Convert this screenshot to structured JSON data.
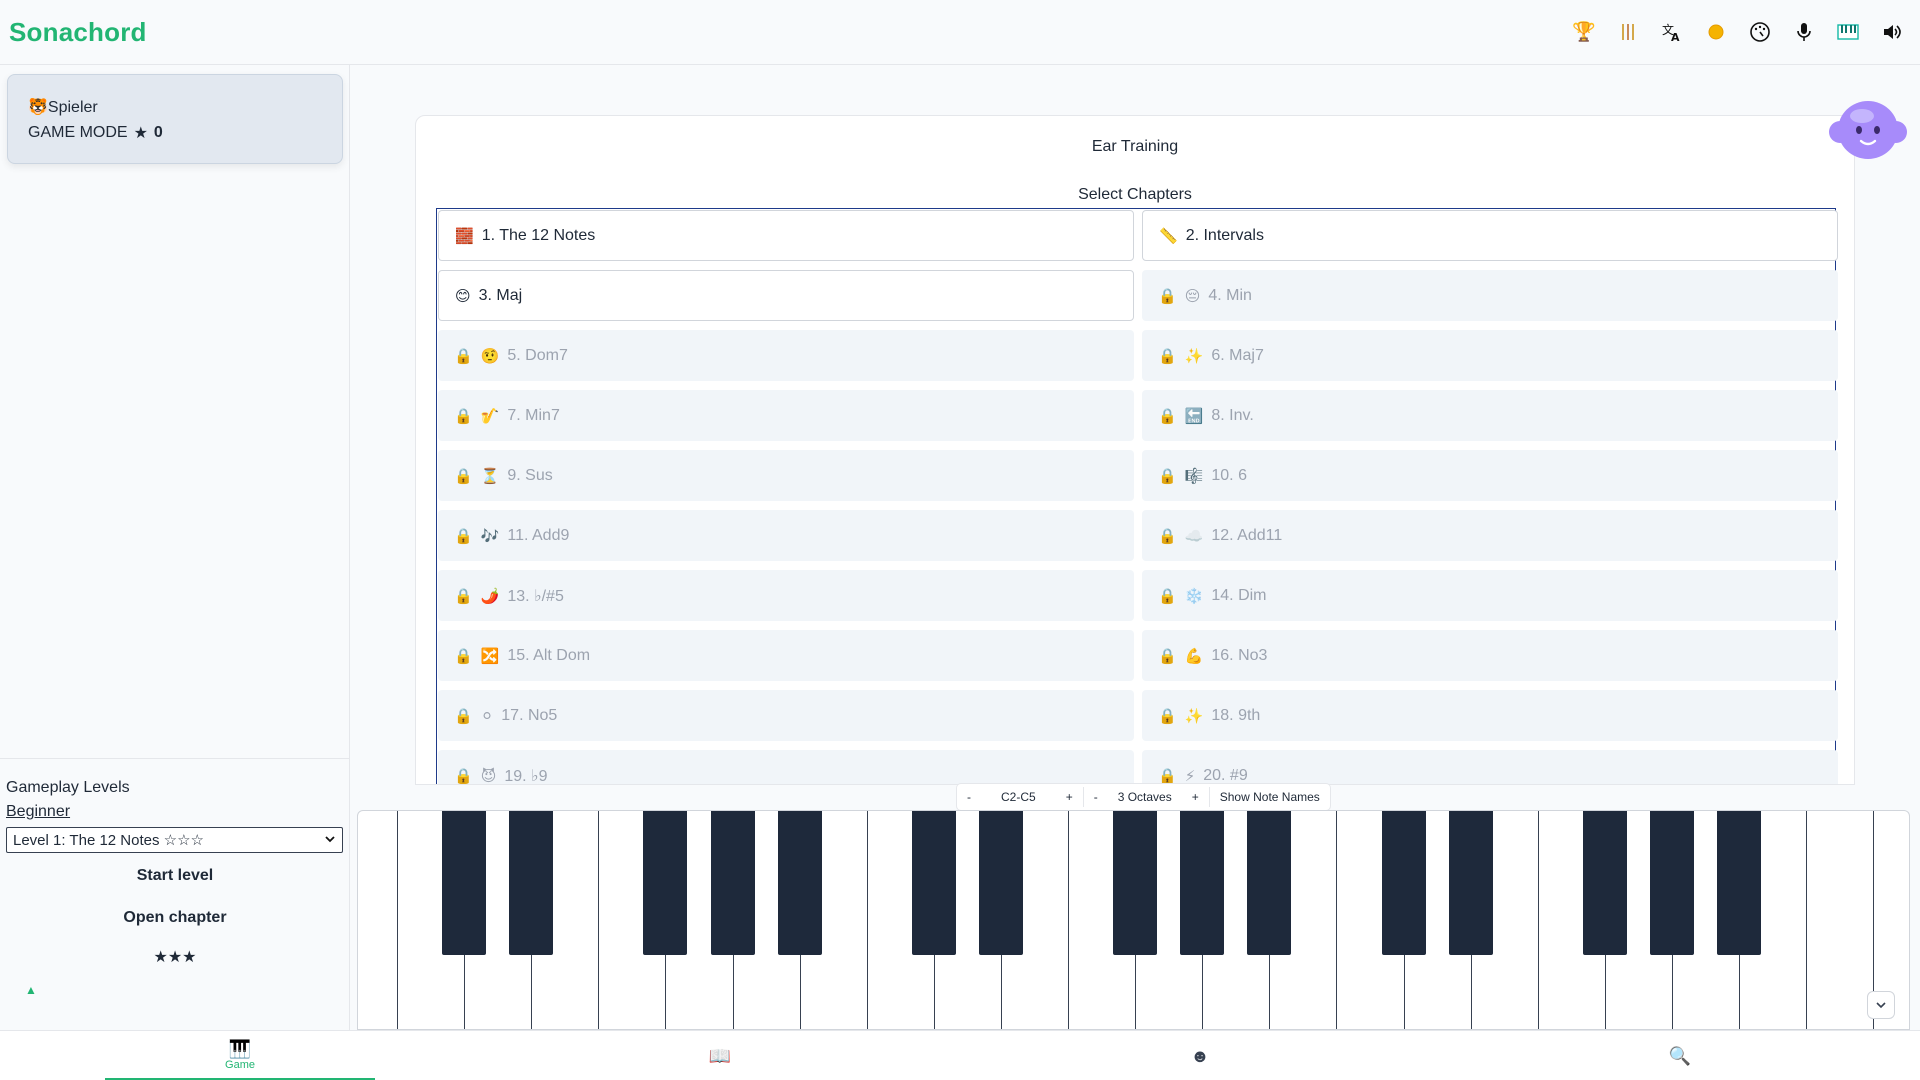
{
  "app": {
    "title": "Sonachord"
  },
  "header": {
    "icons": [
      "trophy-icon",
      "bars-icon",
      "translate-icon",
      "sun-icon",
      "dial-icon",
      "microphone-icon",
      "piano-icon",
      "speaker-icon"
    ]
  },
  "player": {
    "avatar": "🐯",
    "name": "Spieler",
    "mode": "GAME MODE",
    "score_icon": "★",
    "score": "0"
  },
  "sidebar": {
    "levels_title": "Gameplay Levels",
    "difficulty": "Beginner",
    "level_selected": "Level 1: The 12 Notes ☆☆☆",
    "start_label": "Start level",
    "open_label": "Open chapter",
    "stars": "★★★",
    "toggle": "▲"
  },
  "main": {
    "title": "Ear Training",
    "select_title": "Select Chapters",
    "lock_icon": "🔒",
    "chapters": [
      {
        "icon": "🧱",
        "label": "1. The 12 Notes",
        "locked": false
      },
      {
        "icon": "📏",
        "label": "2. Intervals",
        "locked": false
      },
      {
        "icon": "😊",
        "label": "3. Maj",
        "locked": false
      },
      {
        "icon": "😔",
        "label": "4. Min",
        "locked": true
      },
      {
        "icon": "🤨",
        "label": "5. Dom7",
        "locked": true
      },
      {
        "icon": "✨",
        "label": "6. Maj7",
        "locked": true
      },
      {
        "icon": "🎷",
        "label": "7. Min7",
        "locked": true
      },
      {
        "icon": "🔚",
        "label": "8. Inv.",
        "locked": true
      },
      {
        "icon": "⏳",
        "label": "9. Sus",
        "locked": true
      },
      {
        "icon": "🎼",
        "label": "10. 6",
        "locked": true
      },
      {
        "icon": "🎶",
        "label": "11. Add9",
        "locked": true
      },
      {
        "icon": "☁️",
        "label": "12. Add11",
        "locked": true
      },
      {
        "icon": "🌶️",
        "label": "13. ♭/#5",
        "locked": true
      },
      {
        "icon": "❄️",
        "label": "14. Dim",
        "locked": true
      },
      {
        "icon": "🔀",
        "label": "15. Alt Dom",
        "locked": true
      },
      {
        "icon": "💪",
        "label": "16. No3",
        "locked": true
      },
      {
        "icon": "⚪",
        "label": "17. No5",
        "locked": true
      },
      {
        "icon": "✨",
        "label": "18. 9th",
        "locked": true
      },
      {
        "icon": "😈",
        "label": "19. ♭9",
        "locked": true
      },
      {
        "icon": "⚡",
        "label": "20. #9",
        "locked": true
      }
    ]
  },
  "piano_controls": {
    "minus": "-",
    "plus": "+",
    "range": "C2-C5",
    "octaves": "3 Octaves",
    "note_names": "Show Note Names"
  },
  "nav": [
    {
      "icon": "🎹",
      "label": "Game",
      "active": true
    },
    {
      "icon": "📖",
      "label": "",
      "active": false
    },
    {
      "icon": "☻",
      "label": "",
      "active": false
    },
    {
      "icon": "🔍",
      "label": "",
      "active": false
    }
  ],
  "colors": {
    "brand": "#22b573",
    "locked_bg": "#f1f5f9",
    "black_key": "#1e293b"
  }
}
